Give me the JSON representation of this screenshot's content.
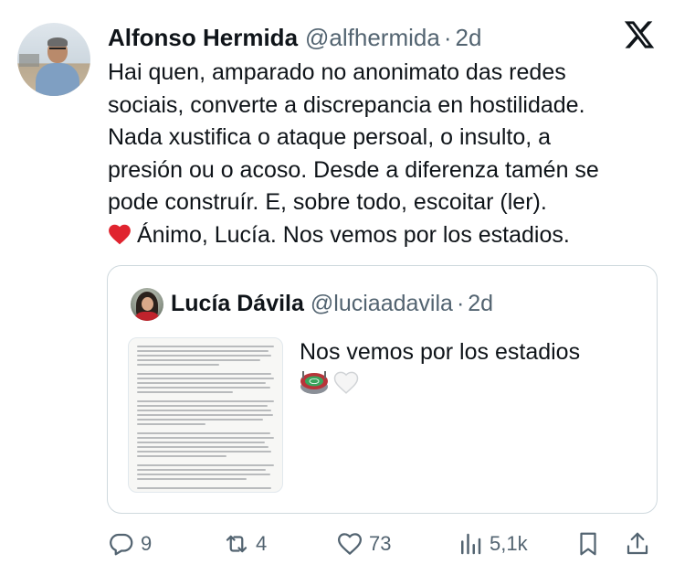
{
  "tweet": {
    "author_name": "Alfonso Hermida",
    "handle": "@alfhermida",
    "separator": "·",
    "time": "2d",
    "lines": [
      "Hai quen, amparado no anonimato das redes",
      "sociais, converte a discrepancia en hostilidade.",
      "Nada xustifica o ataque persoal, o insulto, a",
      "presión ou o acoso. Desde a diferenza tamén se",
      "pode construír. E, sobre todo, escoitar (ler).",
      "Ánimo, Lucía. Nos vemos por los estadios."
    ],
    "last_line_emoji": "red-heart-emoji"
  },
  "quote": {
    "author_name": "Lucía Dávila",
    "handle": "@luciaadavila",
    "separator": "·",
    "time": "2d",
    "text": "Nos vemos por los estadios",
    "emojis": [
      "stadium-emoji",
      "white-heart-emoji"
    ]
  },
  "actions": {
    "replies": "9",
    "reposts": "4",
    "likes": "73",
    "views": "5,1k"
  },
  "colors": {
    "text": "#0f1419",
    "muted": "#536471",
    "border": "#cfd9de",
    "heart_red": "#e0242f"
  }
}
